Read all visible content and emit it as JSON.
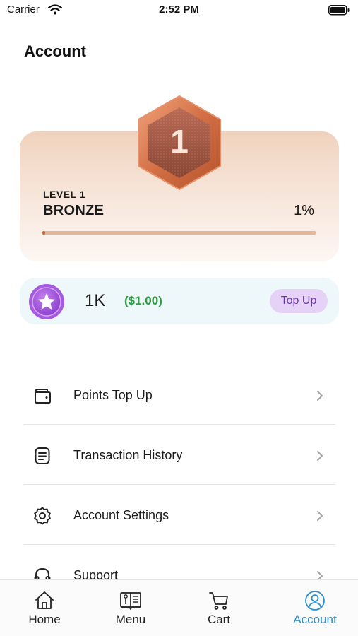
{
  "status_bar": {
    "carrier": "Carrier",
    "time": "2:52 PM"
  },
  "page": {
    "title": "Account"
  },
  "level_card": {
    "badge_number": "1",
    "level_label": "LEVEL 1",
    "tier_name": "BRONZE",
    "percent_label": "1%",
    "progress_fraction": 0.01,
    "colors": {
      "badge": "#c8704a",
      "progress_track": "#e2b699",
      "progress_fill": "#c96a3b"
    }
  },
  "points_card": {
    "icon": "star-coin-icon",
    "points_value": "1K",
    "cash_value": "($1.00)",
    "top_up_label": "Top Up",
    "colors": {
      "coin": "#9b4fd6",
      "cash": "#2a9d3f",
      "top_up_bg": "#e7d2f7",
      "top_up_text": "#6f3aa8"
    }
  },
  "menu": {
    "items": [
      {
        "icon": "wallet-icon",
        "label": "Points Top Up"
      },
      {
        "icon": "receipt-icon",
        "label": "Transaction History"
      },
      {
        "icon": "gear-icon",
        "label": "Account Settings"
      },
      {
        "icon": "headset-icon",
        "label": "Support"
      }
    ]
  },
  "tab_bar": {
    "active": "Account",
    "active_color": "#2f8fc9",
    "tabs": [
      {
        "icon": "home-icon",
        "label": "Home"
      },
      {
        "icon": "menu-book-icon",
        "label": "Menu"
      },
      {
        "icon": "cart-icon",
        "label": "Cart"
      },
      {
        "icon": "account-icon",
        "label": "Account"
      }
    ]
  }
}
